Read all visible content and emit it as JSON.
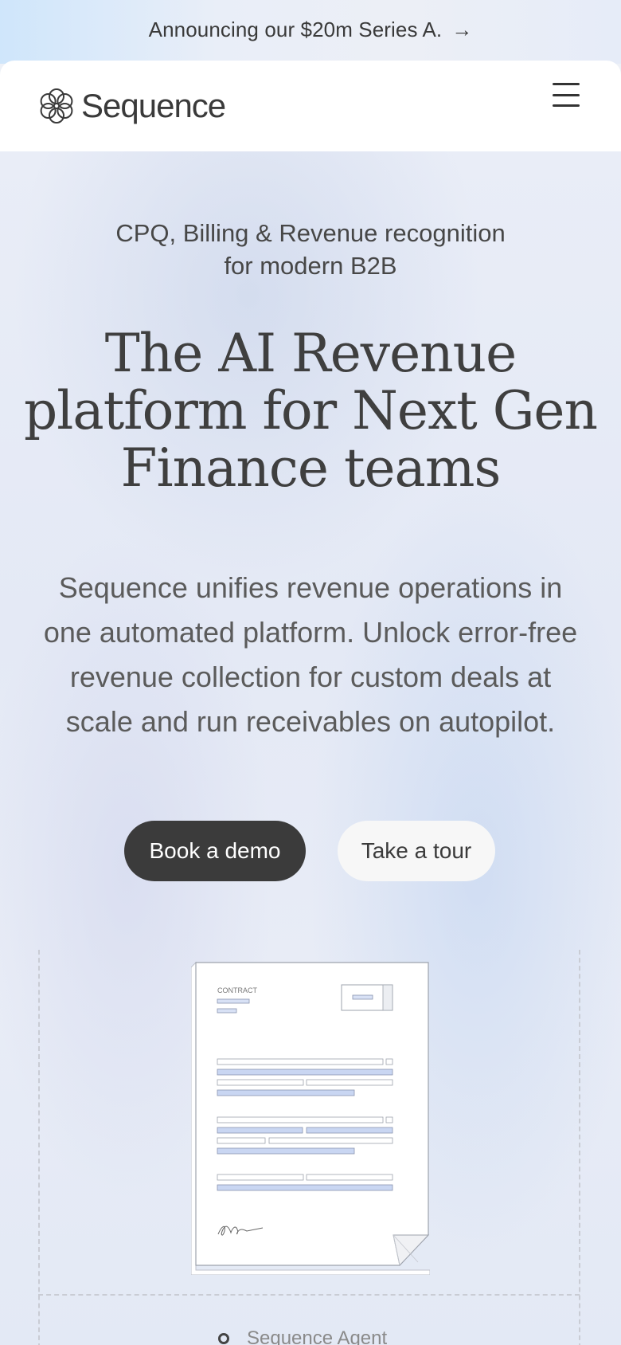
{
  "announcement": {
    "text": "Announcing our $20m Series A.",
    "arrow_icon": "arrow-right-icon"
  },
  "header": {
    "brand": "Sequence",
    "logo_icon": "sequence-flower-logo-icon",
    "menu_icon": "hamburger-menu-icon"
  },
  "hero": {
    "subtitle_line1": "CPQ, Billing & Revenue recognition",
    "subtitle_line2": "for modern B2B",
    "headline_line1": "The AI Revenue",
    "headline_line2": "platform for Next Gen",
    "headline_line3": "Finance teams",
    "description_line1": "Sequence unifies revenue operations in",
    "description_line2": "one automated platform. Unlock error-free",
    "description_line3": "revenue collection for custom deals at",
    "description_line4": "scale and run receivables on autopilot.",
    "primary_cta": "Book a demo",
    "secondary_cta": "Take a tour"
  },
  "illustration": {
    "contract_label": "CONTRACT",
    "agent_label": "Sequence Agent"
  },
  "colors": {
    "dark_button": "#3b3b3b",
    "light_button": "#f7f7f7",
    "field_blue": "#c9d6f2"
  }
}
